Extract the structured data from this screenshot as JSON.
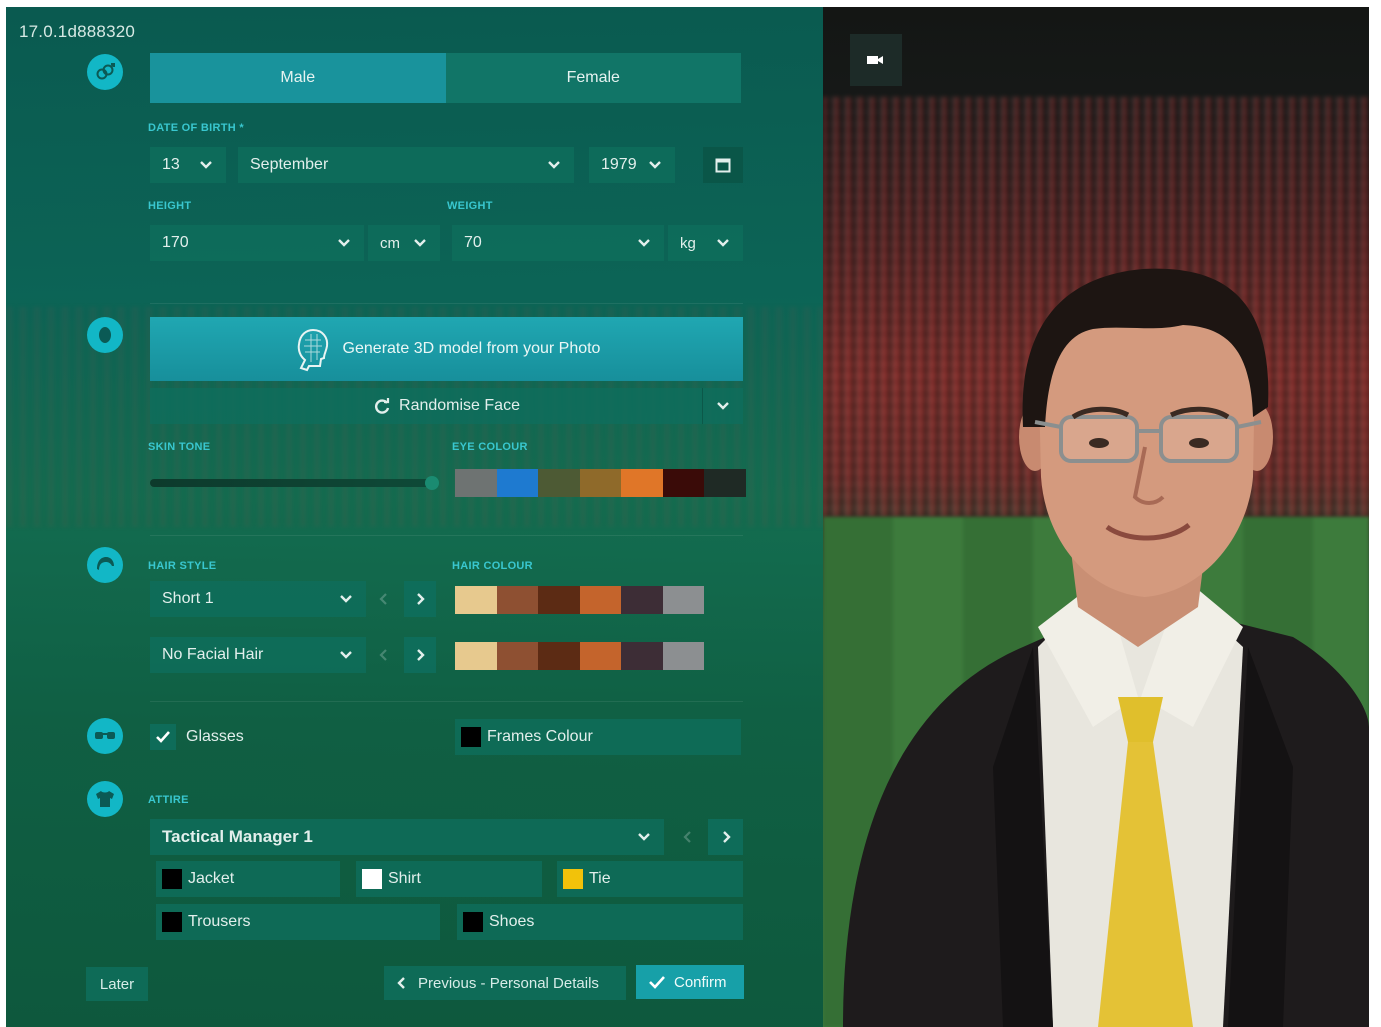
{
  "version": "17.0.1d888320",
  "gender": {
    "male": "Male",
    "female": "Female",
    "selected": "Male"
  },
  "dob": {
    "label": "DATE OF BIRTH *",
    "day": "13",
    "month": "September",
    "year": "1979"
  },
  "height": {
    "label": "HEIGHT",
    "value": "170",
    "unit": "cm"
  },
  "weight": {
    "label": "WEIGHT",
    "value": "70",
    "unit": "kg"
  },
  "face": {
    "generate_label": "Generate 3D model from your Photo",
    "randomise_label": "Randomise Face",
    "skin_tone_label": "SKIN TONE",
    "skin_tone_value": 0.97,
    "eye_colour_label": "EYE COLOUR",
    "eye_colours": [
      "#6e7372",
      "#1e7ad0",
      "#4d5a34",
      "#8f6a2a",
      "#e07628",
      "#3a0b08",
      "#1f2a25"
    ]
  },
  "hair": {
    "style_label": "HAIR STYLE",
    "style_value": "Short 1",
    "colour_label": "HAIR COLOUR",
    "facial_value": "No Facial Hair",
    "hair_colours": [
      "#e7c98e",
      "#8e5032",
      "#5c2b14",
      "#c4642c",
      "#3d2d36",
      "#8c8f91"
    ],
    "facial_colours": [
      "#e7c98e",
      "#8e5032",
      "#5c2b14",
      "#c4642c",
      "#3d2d36",
      "#8c8f91"
    ]
  },
  "glasses": {
    "label": "Glasses",
    "checked": true,
    "frames_label": "Frames Colour",
    "frames_color": "#000000"
  },
  "attire": {
    "label": "ATTIRE",
    "value": "Tactical Manager 1",
    "items": [
      {
        "label": "Jacket",
        "color": "#000000"
      },
      {
        "label": "Shirt",
        "color": "#ffffff"
      },
      {
        "label": "Tie",
        "color": "#f2c20a"
      },
      {
        "label": "Trousers",
        "color": "#000000"
      },
      {
        "label": "Shoes",
        "color": "#000000"
      }
    ]
  },
  "footer": {
    "later": "Later",
    "previous": "Previous - Personal Details",
    "confirm": "Confirm"
  },
  "colors": {
    "accent": "#12b7c6",
    "panel": "#0f6a55",
    "confirm": "#17a0a8"
  },
  "icons": [
    "gender-icon",
    "head-icon",
    "hair-icon",
    "glasses-icon",
    "shirt-icon",
    "camera-icon",
    "calendar-icon"
  ]
}
